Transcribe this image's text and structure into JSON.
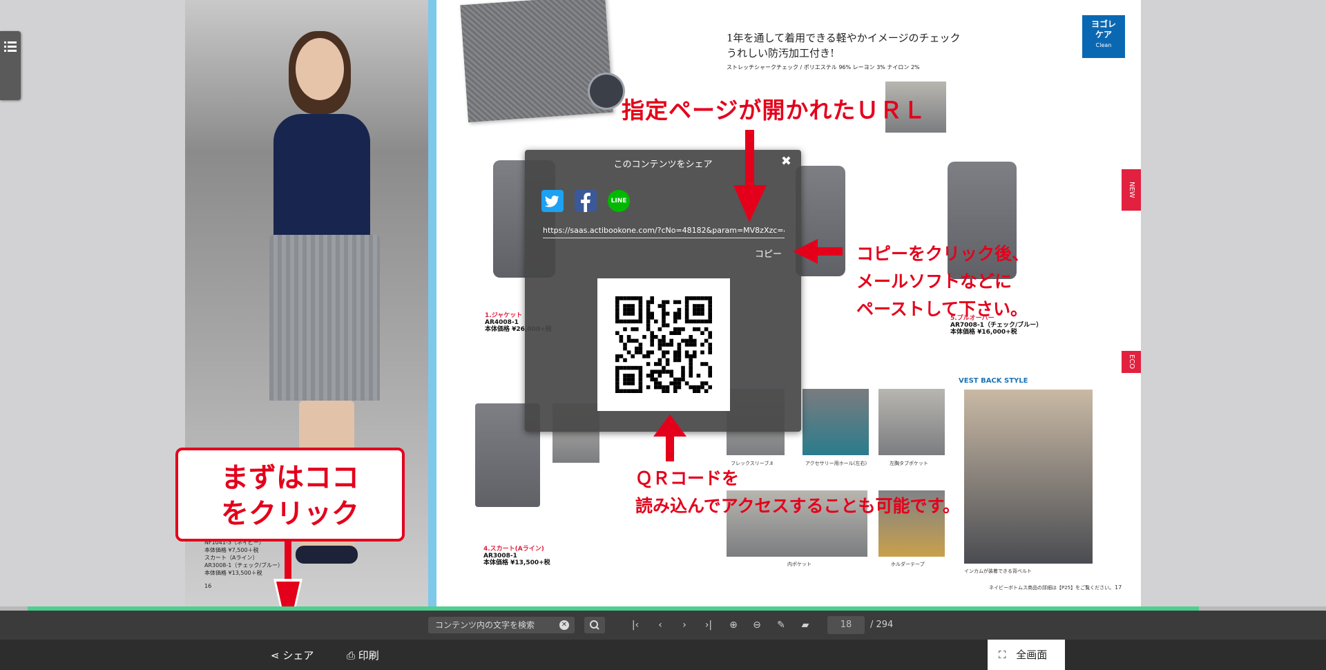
{
  "side_menu": {
    "icon": "list-icon"
  },
  "left_page": {
    "caption_lines": [
      "NF1041-3（ネイビー）",
      "本体価格 ¥7,500＋税",
      "スカート（Aライン）",
      "AR3008-1（チェック/ブルー）",
      "本体価格 ¥13,500＋税"
    ],
    "page_number": "16"
  },
  "right_page": {
    "heading_line1": "1年を通して着用できる軽やかイメージのチェック",
    "heading_line2": "うれしい防汚加工付き!",
    "fabric_spec": "ストレッチシャークチェック / ポリエステル 96%  レーヨン 3%  ナイロン 2%",
    "badge_line1": "ヨゴレ",
    "badge_line2": "ケア",
    "badge_line3": "Clean",
    "tab_new": "NEW",
    "tab_eco": "ECO",
    "item1_num": "1.ジャケット",
    "item1_code": "AR4008-1",
    "item1_price": "本体価格 ¥26,000+税",
    "item5_num": "5.プルオーバー",
    "item5_code": "AR7008-1（チェック/ブルー）",
    "item5_price": "本体価格 ¥16,000+税",
    "item4_num": "4.スカート(Aライン)",
    "item4_code": "AR3008-1",
    "item4_price": "本体価格 ¥13,500+税",
    "vest_back": "VEST BACK STYLE",
    "detail_b": "アクセサリー用ホール(左右)",
    "detail_c": "左胸タブポケット",
    "detail_a": "フレックスリーブ.Ⅱ",
    "detail_d": "内ポケット",
    "detail_e": "ホルダーテープ",
    "inkam": "インカムが装着できる背ベルト",
    "footer_note": "ネイビーボトムス商品の詳細は【P25】をご覧ください。",
    "page_number": "17"
  },
  "share_dialog": {
    "title": "このコンテンツをシェア",
    "close": "✖",
    "twitter_icon": "twitter-icon",
    "facebook_icon": "facebook-icon",
    "line_icon": "line-icon",
    "line_label": "LINE",
    "url": "https://saas.actibookone.com/?cNo=48182&param=MV8zXzc=&",
    "copy_label": "コピー"
  },
  "annotations": {
    "url_note": "指定ページが開かれたＵＲＬ",
    "copy_note_line1": "コピーをクリック後、",
    "copy_note_line2": "メールソフトなどに",
    "copy_note_line3": "ペーストして下さい。",
    "qr_note_line1": "ＱＲコードを",
    "qr_note_line2": "読み込んでアクセスすることも可能です。",
    "click_line1": "まずはココ",
    "click_line2": "をクリック"
  },
  "toolbar": {
    "search_placeholder": "コンテンツ内の文字を検索",
    "current_page": "18",
    "total_pages": "/ 294"
  },
  "bottombar": {
    "share_label": "シェア",
    "print_label": "印刷",
    "fullscreen_label": "全画面"
  },
  "colors": {
    "accent_red": "#e4001b",
    "progress_green": "#4cd08f",
    "toolbar_bg": "#3b3b3b",
    "twitter": "#1da1f2",
    "facebook": "#3b5998",
    "line": "#00b900"
  }
}
